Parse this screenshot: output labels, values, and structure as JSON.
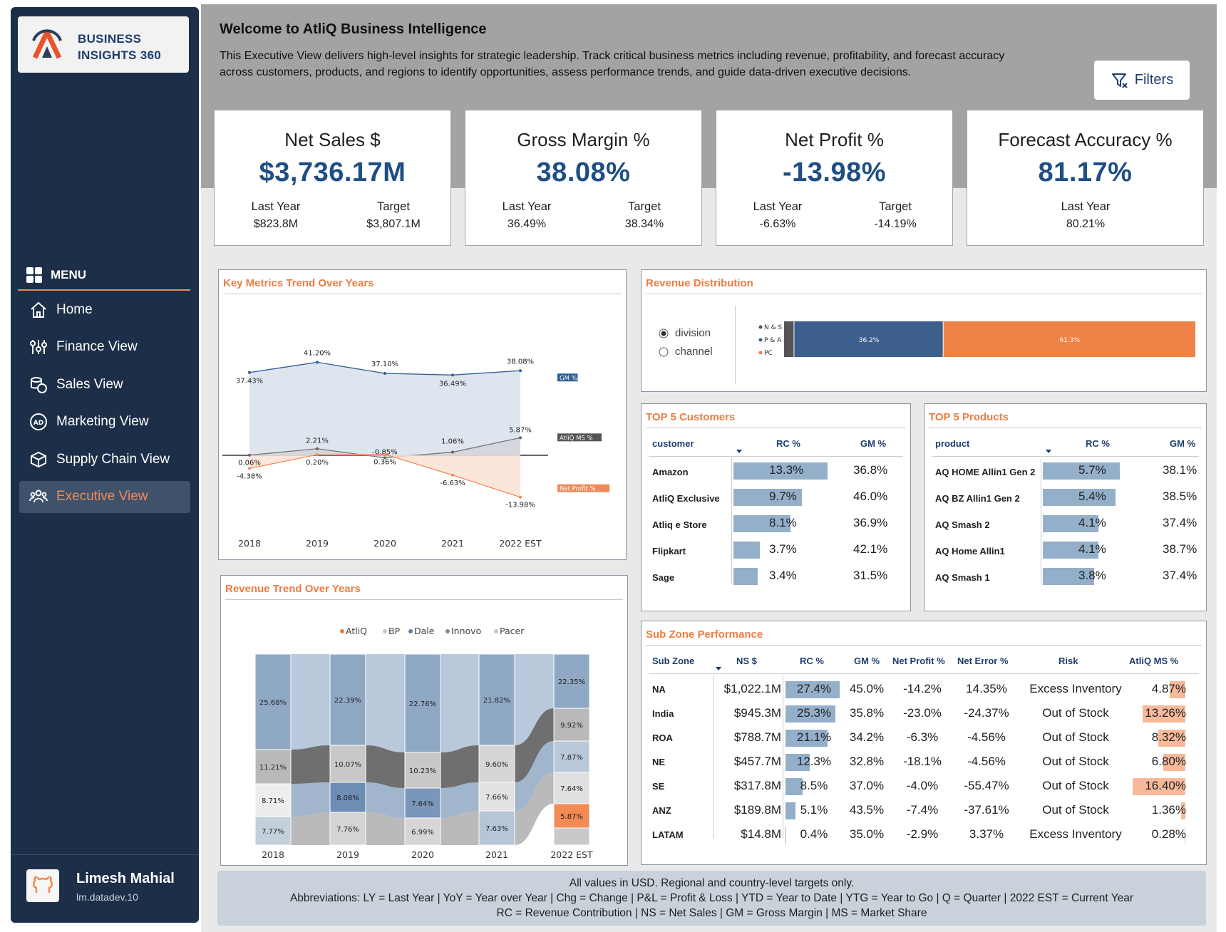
{
  "brand": {
    "line1": "BUSINESS",
    "line2": "INSIGHTS 360"
  },
  "menu": {
    "title": "MENU",
    "items": [
      {
        "label": "Home",
        "icon": "home-icon"
      },
      {
        "label": "Finance View",
        "icon": "sliders-icon"
      },
      {
        "label": "Sales View",
        "icon": "coins-icon"
      },
      {
        "label": "Marketing View",
        "icon": "ad-icon"
      },
      {
        "label": "Supply Chain View",
        "icon": "package-icon"
      },
      {
        "label": "Executive View",
        "icon": "team-icon"
      }
    ]
  },
  "user": {
    "name": "Limesh Mahial",
    "handle": "lm.datadev.10"
  },
  "header": {
    "welcome": "Welcome to AtliQ Business Intelligence",
    "description": "This Executive View delivers high-level insights for strategic leadership. Track critical business metrics including revenue, profitability, and forecast accuracy across customers, products, and regions to identify opportunities, assess performance trends, and guide data-driven executive decisions.",
    "filters": "Filters"
  },
  "kpis": [
    {
      "title": "Net Sales $",
      "value": "$3,736.17M",
      "ly_label": "Last Year",
      "ly": "$823.8M",
      "tg_label": "Target",
      "tg": "$3,807.1M"
    },
    {
      "title": "Gross Margin %",
      "value": "38.08%",
      "ly_label": "Last Year",
      "ly": "36.49%",
      "tg_label": "Target",
      "tg": "38.34%"
    },
    {
      "title": "Net Profit %",
      "value": "-13.98%",
      "ly_label": "Last Year",
      "ly": "-6.63%",
      "tg_label": "Target",
      "tg": "-14.19%"
    },
    {
      "title": "Forecast Accuracy %",
      "value": "81.17%",
      "ly_label": "Last Year",
      "ly": "80.21%"
    }
  ],
  "key_metrics": {
    "title": "Key Metrics Trend Over Years",
    "years": [
      "2018",
      "2019",
      "2020",
      "2021",
      "2022 EST"
    ],
    "gm": [
      "37.43%",
      "41.20%",
      "37.10%",
      "36.49%",
      "38.08%"
    ],
    "ms": [
      "0.06%",
      "2.21%",
      "-0.85%",
      "1.06%",
      "5.87%"
    ],
    "np": [
      "-4.38%",
      "0.20%",
      "0.36%",
      "-6.63%",
      "-13.98%"
    ],
    "legend": [
      "GM %",
      "AtliQ MS %",
      "Net Profit %"
    ]
  },
  "revenue_trend": {
    "title": "Revenue Trend Over Years",
    "legend": [
      "AtliQ",
      "BP",
      "Dale",
      "Innovo",
      "Pacer"
    ],
    "years": [
      "2018",
      "2019",
      "2020",
      "2021",
      "2022 EST"
    ],
    "labels": {
      "c0": [
        "25.68%",
        "11.21%",
        "8.71%",
        "7.77%"
      ],
      "c1": [
        "22.39%",
        "10.07%",
        "8.08%",
        "7.76%"
      ],
      "c2": [
        "22.76%",
        "10.23%",
        "7.64%",
        "6.99%"
      ],
      "c3": [
        "21.82%",
        "9.60%",
        "7.66%",
        "7.63%"
      ],
      "c4": [
        "22.35%",
        "9.92%",
        "7.87%",
        "7.64%",
        "5.87%"
      ]
    }
  },
  "revenue_distribution": {
    "title": "Revenue Distribution",
    "options": [
      "division",
      "channel"
    ],
    "selected": "division",
    "legend": [
      "N & S",
      "P & A",
      "PC"
    ],
    "values": [
      "36.2%",
      "61.3%"
    ],
    "fractions": [
      0.025,
      0.362,
      0.613
    ]
  },
  "top_customers": {
    "title": "TOP 5 Customers",
    "headers": [
      "customer",
      "RC %",
      "GM %"
    ],
    "rows": [
      {
        "name": "Amazon",
        "rc": "13.3%",
        "gm": "36.8%",
        "bar": 13.3
      },
      {
        "name": "AtliQ Exclusive",
        "rc": "9.7%",
        "gm": "46.0%",
        "bar": 9.7
      },
      {
        "name": "Atliq e Store",
        "rc": "8.1%",
        "gm": "36.9%",
        "bar": 8.1
      },
      {
        "name": "Flipkart",
        "rc": "3.7%",
        "gm": "42.1%",
        "bar": 3.7
      },
      {
        "name": "Sage",
        "rc": "3.4%",
        "gm": "31.5%",
        "bar": 3.4
      }
    ]
  },
  "top_products": {
    "title": "TOP 5 Products",
    "headers": [
      "product",
      "RC %",
      "GM %"
    ],
    "rows": [
      {
        "name": "AQ HOME Allin1 Gen 2",
        "rc": "5.7%",
        "gm": "38.1%",
        "bar": 5.7
      },
      {
        "name": "AQ BZ Allin1 Gen 2",
        "rc": "5.4%",
        "gm": "38.5%",
        "bar": 5.4
      },
      {
        "name": "AQ Smash 2",
        "rc": "4.1%",
        "gm": "37.4%",
        "bar": 4.1
      },
      {
        "name": "AQ Home Allin1",
        "rc": "4.1%",
        "gm": "38.7%",
        "bar": 4.1
      },
      {
        "name": "AQ Smash 1",
        "rc": "3.8%",
        "gm": "37.4%",
        "bar": 3.8
      }
    ]
  },
  "sub_zone": {
    "title": "Sub Zone Performance",
    "headers": [
      "Sub Zone",
      "NS $",
      "RC %",
      "GM %",
      "Net Profit %",
      "Net Error %",
      "Risk",
      "AtliQ MS %"
    ],
    "rows": [
      {
        "zone": "NA",
        "ns": "$1,022.1M",
        "rc": "27.4%",
        "gm": "45.0%",
        "np": "-14.2%",
        "ne": "14.35%",
        "risk": "Excess Inventory",
        "ms": "4.87%",
        "rc_v": 27.4,
        "ms_v": 4.87
      },
      {
        "zone": "India",
        "ns": "$945.3M",
        "rc": "25.3%",
        "gm": "35.8%",
        "np": "-23.0%",
        "ne": "-24.37%",
        "risk": "Out of Stock",
        "ms": "13.26%",
        "rc_v": 25.3,
        "ms_v": 13.26
      },
      {
        "zone": "ROA",
        "ns": "$788.7M",
        "rc": "21.1%",
        "gm": "34.2%",
        "np": "-6.3%",
        "ne": "-4.56%",
        "risk": "Out of Stock",
        "ms": "8.32%",
        "rc_v": 21.1,
        "ms_v": 8.32
      },
      {
        "zone": "NE",
        "ns": "$457.7M",
        "rc": "12.3%",
        "gm": "32.8%",
        "np": "-18.1%",
        "ne": "-4.56%",
        "risk": "Out of Stock",
        "ms": "6.80%",
        "rc_v": 12.3,
        "ms_v": 6.8
      },
      {
        "zone": "SE",
        "ns": "$317.8M",
        "rc": "8.5%",
        "gm": "37.0%",
        "np": "-4.0%",
        "ne": "-55.47%",
        "risk": "Out of Stock",
        "ms": "16.40%",
        "rc_v": 8.5,
        "ms_v": 16.4
      },
      {
        "zone": "ANZ",
        "ns": "$189.8M",
        "rc": "5.1%",
        "gm": "43.5%",
        "np": "-7.4%",
        "ne": "-37.61%",
        "risk": "Out of Stock",
        "ms": "1.36%",
        "rc_v": 5.1,
        "ms_v": 1.36
      },
      {
        "zone": "LATAM",
        "ns": "$14.8M",
        "rc": "0.4%",
        "gm": "35.0%",
        "np": "-2.9%",
        "ne": "3.37%",
        "risk": "Excess Inventory",
        "ms": "0.28%",
        "rc_v": 0.4,
        "ms_v": 0.28
      }
    ]
  },
  "footer": [
    "All values in USD. Regional and country-level targets only.",
    "Abbreviations: LY = Last Year | YoY = Year over Year | Chg = Change | P&L = Profit & Loss | YTD = Year to Date | YTG = Year to Go | Q = Quarter | 2022 EST = Current Year",
    "RC = Revenue Contribution | NS = Net Sales | GM = Gross Margin | MS = Market Share"
  ],
  "colors": {
    "navy": "#1d2f48",
    "accent": "#ec7d43",
    "kpi_blue": "#1f4e84",
    "bar_blue": "#94afca"
  },
  "chart_data": [
    {
      "type": "line",
      "title": "Key Metrics Trend Over Years",
      "x": [
        "2018",
        "2019",
        "2020",
        "2021",
        "2022 EST"
      ],
      "series": [
        {
          "name": "GM %",
          "values": [
            37.43,
            41.2,
            37.1,
            36.49,
            38.08
          ]
        },
        {
          "name": "AtliQ MS %",
          "values": [
            0.06,
            2.21,
            -0.85,
            1.06,
            5.87
          ]
        },
        {
          "name": "Net Profit %",
          "values": [
            -4.38,
            0.2,
            0.36,
            -6.63,
            -13.98
          ]
        }
      ]
    },
    {
      "type": "area",
      "title": "Revenue Trend Over Years",
      "x": [
        "2018",
        "2019",
        "2020",
        "2021",
        "2022 EST"
      ],
      "series": [
        {
          "name": "AtliQ",
          "values": [
            null,
            null,
            null,
            null,
            5.87
          ]
        }
      ]
    }
  ]
}
